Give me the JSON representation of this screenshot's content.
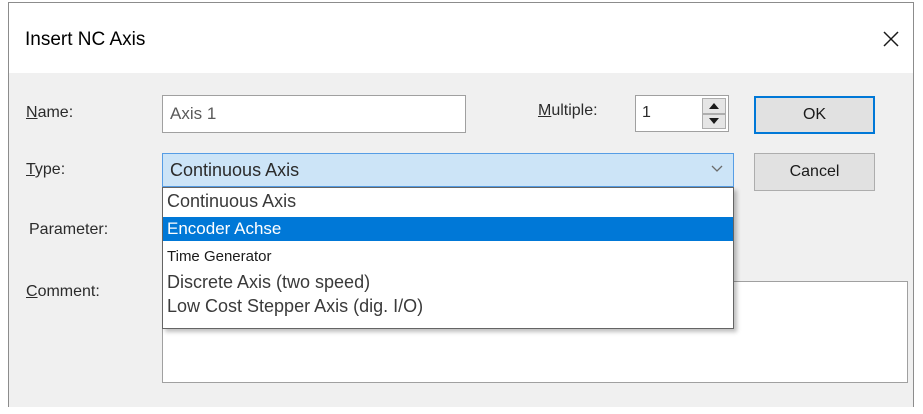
{
  "window": {
    "title": "Insert NC Axis",
    "close_icon": "close-icon"
  },
  "form": {
    "name_label_accel": "N",
    "name_label_rest": "ame:",
    "name_value": "Axis 1",
    "multiple_label_accel": "M",
    "multiple_label_rest": "ultiple:",
    "multiple_value": "1",
    "type_label_accel": "T",
    "type_label_rest": "ype:",
    "type_value": "Continuous Axis",
    "parameter_label": "Parameter:",
    "comment_label_accel": "C",
    "comment_label_rest": "omment:",
    "comment_value": ""
  },
  "dropdown": {
    "items": [
      {
        "label": "Continuous Axis"
      },
      {
        "label": "Encoder Achse"
      },
      {
        "label": "Time Generator"
      },
      {
        "label": "Discrete Axis (two speed)"
      },
      {
        "label": "Low Cost Stepper Axis (dig. I/O)"
      }
    ],
    "selected": "Encoder Achse"
  },
  "buttons": {
    "ok_label": "OK",
    "cancel_label": "Cancel"
  },
  "colors": {
    "accent": "#0078d7",
    "combo_bg": "#cce4f7",
    "dialog_bg": "#f0f0f0"
  }
}
